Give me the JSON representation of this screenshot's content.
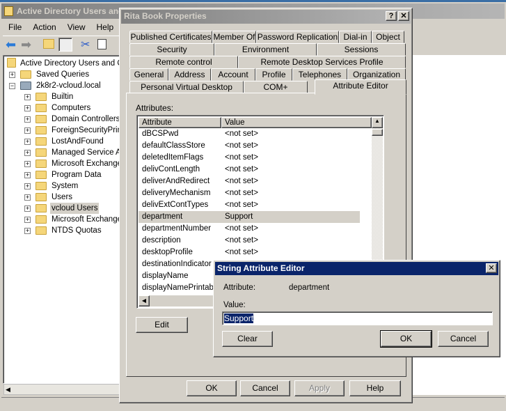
{
  "main_window": {
    "title": "Active Directory Users and Computers",
    "menu": [
      "File",
      "Action",
      "View",
      "Help"
    ],
    "tree": {
      "root": "Active Directory Users and Computers",
      "items": [
        {
          "label": "Saved Queries",
          "level": 1,
          "expander": "+"
        },
        {
          "label": "2k8r2-vcloud.local",
          "level": 1,
          "expander": "-",
          "icon": "domain-icon"
        },
        {
          "label": "Builtin",
          "level": 2,
          "expander": "+"
        },
        {
          "label": "Computers",
          "level": 2,
          "expander": "+"
        },
        {
          "label": "Domain Controllers",
          "level": 2,
          "expander": "+",
          "icon": "ou-icon"
        },
        {
          "label": "ForeignSecurityPrincipals",
          "level": 2,
          "expander": "+"
        },
        {
          "label": "LostAndFound",
          "level": 2,
          "expander": "+"
        },
        {
          "label": "Managed Service Accounts",
          "level": 2,
          "expander": "+"
        },
        {
          "label": "Microsoft Exchange Security Groups",
          "level": 2,
          "expander": "+",
          "icon": "ou-icon"
        },
        {
          "label": "Program Data",
          "level": 2,
          "expander": "+"
        },
        {
          "label": "System",
          "level": 2,
          "expander": "+"
        },
        {
          "label": "Users",
          "level": 2,
          "expander": "+"
        },
        {
          "label": "vcloud Users",
          "level": 2,
          "expander": "+",
          "icon": "ou-icon",
          "selected": true
        },
        {
          "label": "Microsoft Exchange System Objects",
          "level": 2,
          "expander": "+"
        },
        {
          "label": "NTDS Quotas",
          "level": 2,
          "expander": "+"
        }
      ]
    }
  },
  "properties": {
    "title": "Rita Book Properties",
    "tab_rows": [
      [
        "Published Certificates",
        "Member Of",
        "Password Replication",
        "Dial-in",
        "Object"
      ],
      [
        "Security",
        "Environment",
        "Sessions"
      ],
      [
        "Remote control",
        "Remote Desktop Services Profile"
      ],
      [
        "General",
        "Address",
        "Account",
        "Profile",
        "Telephones",
        "Organization"
      ],
      [
        "Personal Virtual Desktop",
        "COM+",
        "Attribute Editor"
      ]
    ],
    "attributes_label": "Attributes:",
    "columns": [
      "Attribute",
      "Value"
    ],
    "rows": [
      [
        "dBCSPwd",
        "<not set>"
      ],
      [
        "defaultClassStore",
        "<not set>"
      ],
      [
        "deletedItemFlags",
        "<not set>"
      ],
      [
        "delivContLength",
        "<not set>"
      ],
      [
        "deliverAndRedirect",
        "<not set>"
      ],
      [
        "deliveryMechanism",
        "<not set>"
      ],
      [
        "delivExtContTypes",
        "<not set>"
      ],
      [
        "department",
        "Support"
      ],
      [
        "departmentNumber",
        "<not set>"
      ],
      [
        "description",
        "<not set>"
      ],
      [
        "desktopProfile",
        "<not set>"
      ],
      [
        "destinationIndicator",
        ""
      ],
      [
        "displayName",
        ""
      ],
      [
        "displayNamePrintable",
        ""
      ]
    ],
    "edit": "Edit",
    "ok": "OK",
    "cancel": "Cancel",
    "apply": "Apply",
    "help": "Help"
  },
  "string_editor": {
    "title": "String Attribute Editor",
    "attribute_label": "Attribute:",
    "attribute_value": "department",
    "value_label": "Value:",
    "value": "Support",
    "clear": "Clear",
    "ok": "OK",
    "cancel": "Cancel"
  }
}
